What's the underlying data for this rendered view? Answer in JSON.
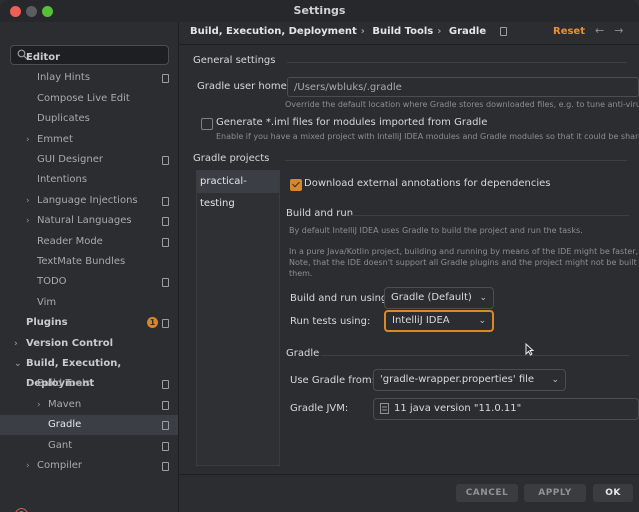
{
  "window": {
    "title": "Settings"
  },
  "search": {
    "placeholder": ""
  },
  "sidebar": {
    "items": [
      {
        "label": "Editor",
        "kind": "head",
        "arrow": ""
      },
      {
        "label": "Inlay Hints",
        "kind": "sub",
        "arrow": ""
      },
      {
        "label": "Compose Live Edit",
        "kind": "sub",
        "arrow": ""
      },
      {
        "label": "Duplicates",
        "kind": "sub",
        "arrow": ""
      },
      {
        "label": "Emmet",
        "kind": "sub",
        "arrow": "›"
      },
      {
        "label": "GUI Designer",
        "kind": "sub",
        "arrow": ""
      },
      {
        "label": "Intentions",
        "kind": "sub",
        "arrow": ""
      },
      {
        "label": "Language Injections",
        "kind": "sub",
        "arrow": "›"
      },
      {
        "label": "Natural Languages",
        "kind": "sub",
        "arrow": "›"
      },
      {
        "label": "Reader Mode",
        "kind": "sub",
        "arrow": ""
      },
      {
        "label": "TextMate Bundles",
        "kind": "sub",
        "arrow": ""
      },
      {
        "label": "TODO",
        "kind": "sub",
        "arrow": ""
      },
      {
        "label": "Vim",
        "kind": "sub",
        "arrow": ""
      },
      {
        "label": "Plugins",
        "kind": "head",
        "arrow": "",
        "badge": "1"
      },
      {
        "label": "Version Control",
        "kind": "head",
        "arrow": "›"
      },
      {
        "label": "Build, Execution, Deployment",
        "kind": "head",
        "arrow": "⌄"
      },
      {
        "label": "Build Tools",
        "kind": "sub",
        "arrow": "⌄"
      },
      {
        "label": "Maven",
        "kind": "sub2",
        "arrow": "›"
      },
      {
        "label": "Gradle",
        "kind": "sub2",
        "arrow": "",
        "selected": true
      },
      {
        "label": "Gant",
        "kind": "sub2",
        "arrow": ""
      },
      {
        "label": "Compiler",
        "kind": "sub",
        "arrow": "›"
      }
    ]
  },
  "breadcrumb": {
    "parts": [
      "Build, Execution, Deployment",
      "Build Tools",
      "Gradle"
    ],
    "sep": "›"
  },
  "header": {
    "reset_label": "Reset",
    "back": "←",
    "forward": "→"
  },
  "general": {
    "title": "General settings",
    "user_home_label": "Gradle user home:",
    "user_home_value": "/Users/wbluks/.gradle",
    "user_home_hint": "Override the default location where Gradle stores downloaded files, e.g. to tune anti-virus so",
    "iml_label": "Generate *.iml files for modules imported from Gradle",
    "iml_hint": "Enable if you have a mixed project with IntelliJ IDEA modules and Gradle modules so that it could be shared via V",
    "iml_checked": false
  },
  "projects": {
    "title": "Gradle projects",
    "list": [
      "practical-testing"
    ],
    "annotations_label": "Download external annotations for dependencies",
    "annotations_checked": true
  },
  "build_run": {
    "title": "Build and run",
    "desc1": "By default IntelliJ IDEA uses Gradle to build the project and run the tasks.",
    "desc2a": "In a pure Java/Kotlin project, building and running by means of the IDE might be faster, than",
    "desc2b": "Note, that the IDE doesn't support all Gradle plugins and the project might not be built corre",
    "desc2c": "them.",
    "build_label": "Build and run using:",
    "build_value": "Gradle (Default)",
    "tests_label": "Run tests using:",
    "tests_value": "IntelliJ IDEA"
  },
  "gradle": {
    "title": "Gradle",
    "use_from_label": "Use Gradle from:",
    "use_from_value": "'gradle-wrapper.properties' file",
    "jvm_label": "Gradle JVM:",
    "jvm_value": "11 java version \"11.0.11\""
  },
  "footer": {
    "cancel": "CANCEL",
    "apply": "APPLY",
    "ok": "OK"
  },
  "colors": {
    "accent": "#d9862a",
    "bg": "#2b2d30",
    "selected": "#3b3f45"
  }
}
